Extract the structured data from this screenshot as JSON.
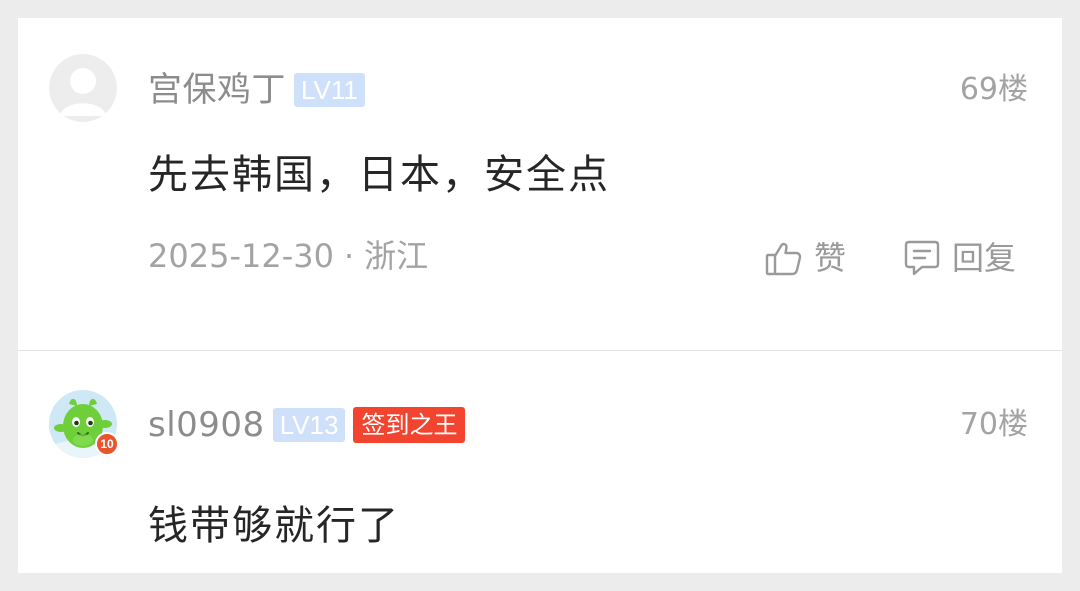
{
  "comments": [
    {
      "username": "宫保鸡丁",
      "level": "LV11",
      "floor": "69楼",
      "content": "先去韩国，日本，安全点",
      "date": "2025-12-30",
      "separator": "·",
      "location": "浙江",
      "like_label": "赞",
      "reply_label": "回复",
      "avatar_icon": "default-user-avatar"
    },
    {
      "username": "sl0908",
      "level": "LV13",
      "title_badge": "签到之王",
      "floor": "70楼",
      "content": "钱带够就行了",
      "avatar_icon": "green-mascot-avatar",
      "avatar_badge": "10"
    }
  ],
  "colors": {
    "level_badge_bg": "#cfe0fb",
    "title_badge_bg": "#f2442e",
    "text_primary": "#262626",
    "text_secondary": "#a3a3a3"
  }
}
